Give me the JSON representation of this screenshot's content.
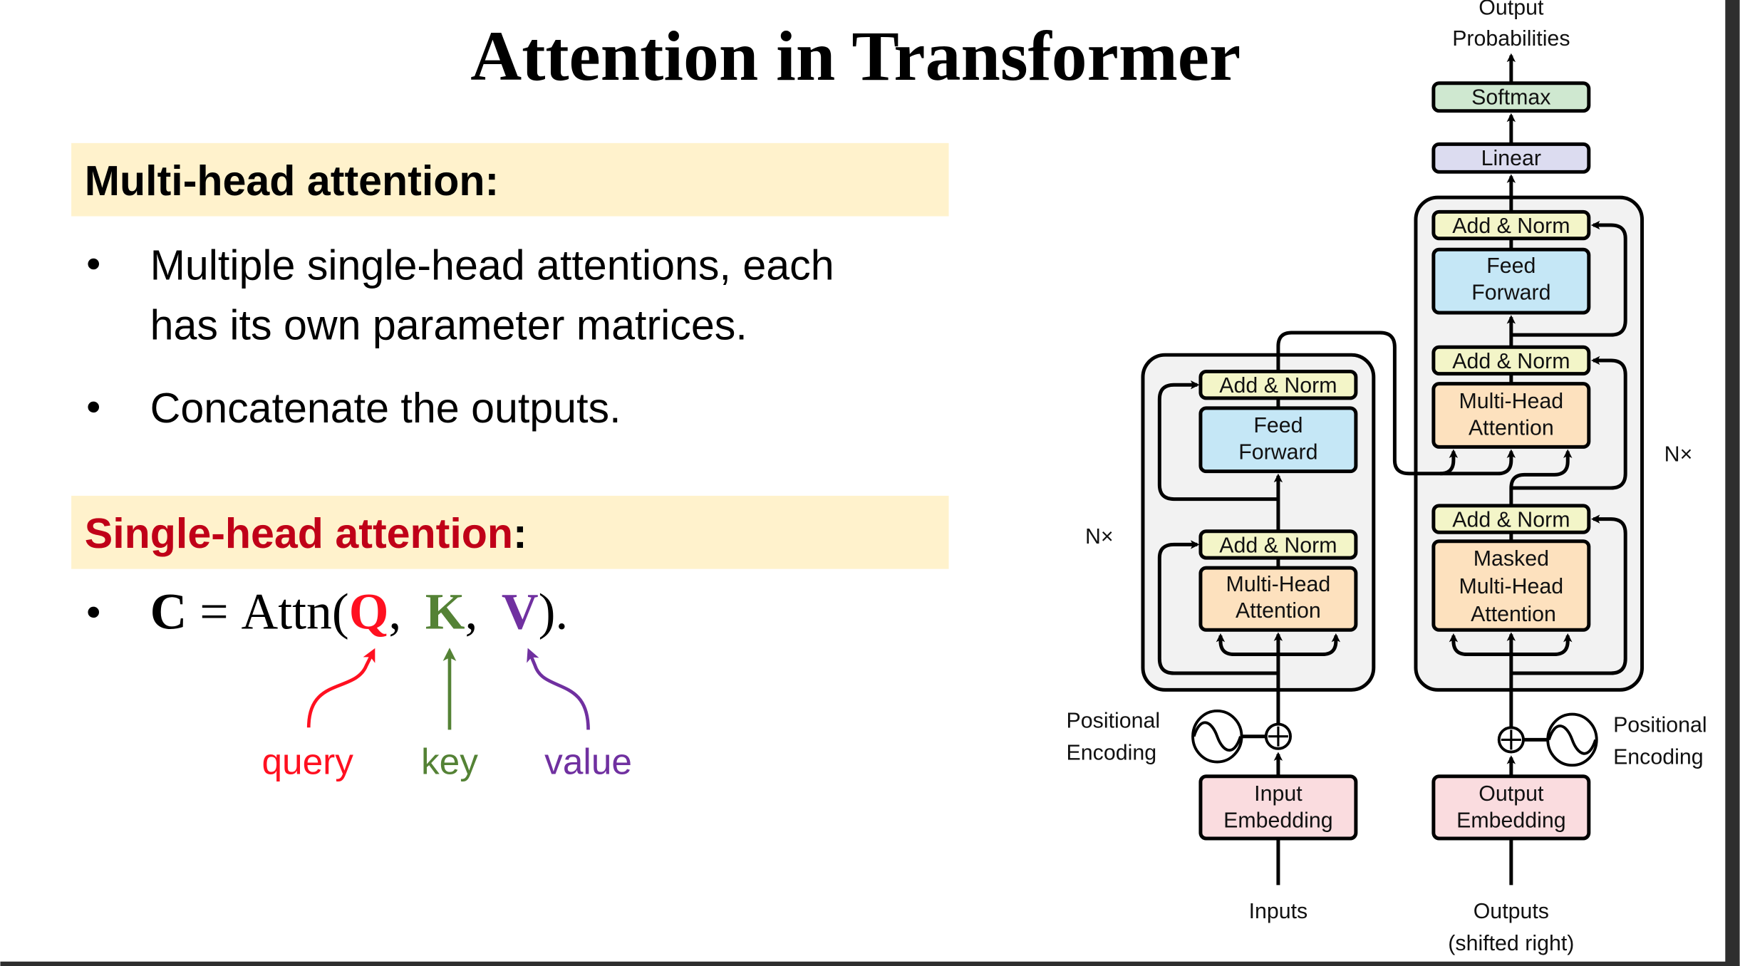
{
  "slide": {
    "title": "Attention in Transformer",
    "multi_head": {
      "heading": "Multi-head attention:",
      "bullets": [
        [
          "Multiple single-head attentions, each",
          "has its own parameter matrices."
        ],
        [
          "Concatenate the outputs."
        ]
      ]
    },
    "single_head": {
      "heading": "Single-head attention",
      "heading_colon": ":",
      "formula": {
        "lhs": "C",
        "eq": "=",
        "fn": "Attn(",
        "q": "Q",
        "comma1": ",",
        "k": "K",
        "comma2": ",",
        "v": "V",
        "close": ")."
      },
      "labels": {
        "query": "query",
        "key": "key",
        "value": "value"
      }
    },
    "colors": {
      "band": "#FFF2CC",
      "heading_red": "#C00018",
      "query": "#FF1020",
      "key": "#548235",
      "value": "#7030A0"
    }
  },
  "diagram": {
    "output_probabilities": [
      "Output",
      "Probabilities"
    ],
    "softmax": "Softmax",
    "linear": "Linear",
    "add_norm": "Add & Norm",
    "feed_forward": [
      "Feed",
      "Forward"
    ],
    "multi_head_attention": [
      "Multi-Head",
      "Attention"
    ],
    "masked_mha": [
      "Masked",
      "Multi-Head",
      "Attention"
    ],
    "input_embedding": [
      "Input",
      "Embedding"
    ],
    "output_embedding": [
      "Output",
      "Embedding"
    ],
    "positional_encoding": [
      "Positional",
      "Encoding"
    ],
    "nx": "N×",
    "inputs": "Inputs",
    "outputs": [
      "Outputs",
      "(shifted right)"
    ],
    "colors": {
      "softmax": "#CFE8D0",
      "linear": "#DCDCF0",
      "add_norm": "#F3F5C8",
      "feed_forward": "#C5E7F6",
      "attention": "#FDE1BE",
      "embedding": "#FADCDF",
      "block": "#F2F2F2"
    }
  }
}
